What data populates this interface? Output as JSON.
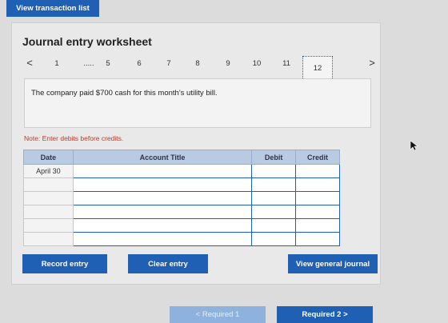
{
  "top": {
    "view_transaction_list": "View transaction list"
  },
  "worksheet": {
    "title": "Journal entry worksheet",
    "pager": {
      "prev": "<",
      "next": ">",
      "items": [
        "1",
        ".....",
        "5",
        "6",
        "7",
        "8",
        "9",
        "10",
        "11",
        "12"
      ],
      "active": "12"
    },
    "description": "The company paid $700 cash for this month's utility bill.",
    "note": "Note: Enter debits before credits.",
    "table": {
      "headers": [
        "Date",
        "Account Title",
        "Debit",
        "Credit"
      ],
      "rows": [
        {
          "date": "April 30"
        },
        {
          "date": ""
        },
        {
          "date": ""
        },
        {
          "date": ""
        },
        {
          "date": ""
        },
        {
          "date": ""
        }
      ]
    },
    "buttons": {
      "record": "Record entry",
      "clear": "Clear entry",
      "view_general": "View general journal"
    }
  },
  "footer": {
    "required_prev": "< Required 1",
    "required_next": "Required 2  >"
  },
  "colors": {
    "button_blue": "#1f5fb4",
    "header_blue": "#b9cbe2",
    "note_red": "#c0392b"
  }
}
